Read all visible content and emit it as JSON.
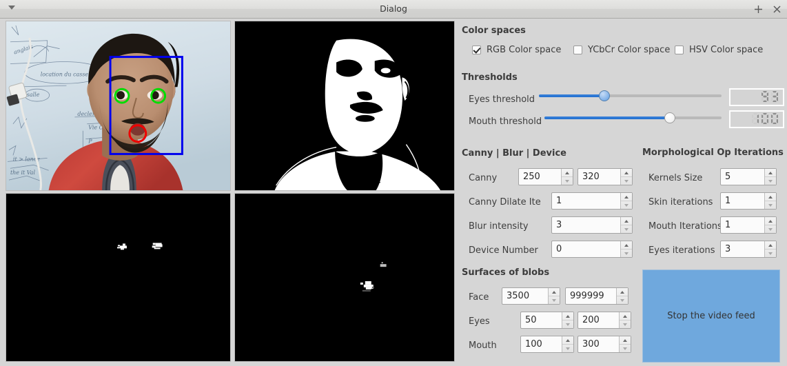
{
  "window": {
    "title": "Dialog",
    "menu_icon": "caret-down-icon",
    "maximize_icon": "maximize-plus-icon",
    "close_icon": "close-x-icon"
  },
  "previews": {
    "webcam": {
      "name": "Webcam feed with face, eyes and mouth detection overlays",
      "face_box_color": "#0000ee",
      "eye_circle_color": "#00dd00",
      "mouth_circle_color": "#ee0000"
    },
    "skin_mask": {
      "name": "Binary skin-segmentation mask"
    },
    "eyes_mask": {
      "name": "Eyes blob mask"
    },
    "mouth_mask": {
      "name": "Mouth blob mask"
    }
  },
  "color_spaces": {
    "title": "Color spaces",
    "options": [
      {
        "label": "RGB Color space",
        "checked": true
      },
      {
        "label": "YCbCr Color space",
        "checked": false
      },
      {
        "label": "HSV Color space",
        "checked": false
      }
    ]
  },
  "thresholds": {
    "title": "Thresholds",
    "items": [
      {
        "label": "Eyes threshold",
        "value": "93",
        "percent": 36
      },
      {
        "label": "Mouth threshold",
        "value": "100",
        "percent": 71
      }
    ]
  },
  "canny_blur_device": {
    "title": "Canny | Blur | Device",
    "rows": [
      {
        "label": "Canny",
        "value": "250",
        "value2": "320"
      },
      {
        "label": "Canny Dilate Ite",
        "value": "1"
      },
      {
        "label": "Blur intensity",
        "value": "3"
      },
      {
        "label": "Device Number",
        "value": "0"
      }
    ]
  },
  "morphological": {
    "title": "Morphological Op Iterations",
    "rows": [
      {
        "label": "Kernels Size",
        "value": "5"
      },
      {
        "label": "Skin iterations",
        "value": "1"
      },
      {
        "label": "Mouth Iterations",
        "value": "1"
      },
      {
        "label": "Eyes iterations",
        "value": "3"
      }
    ]
  },
  "surfaces": {
    "title": "Surfaces of blobs",
    "rows": [
      {
        "label": "Face",
        "min": "3500",
        "max": "999999"
      },
      {
        "label": "Eyes",
        "min": "50",
        "max": "200"
      },
      {
        "label": "Mouth",
        "min": "100",
        "max": "300"
      }
    ]
  },
  "video_button": {
    "label": "Stop the video feed",
    "color": "#6fa8dd"
  }
}
